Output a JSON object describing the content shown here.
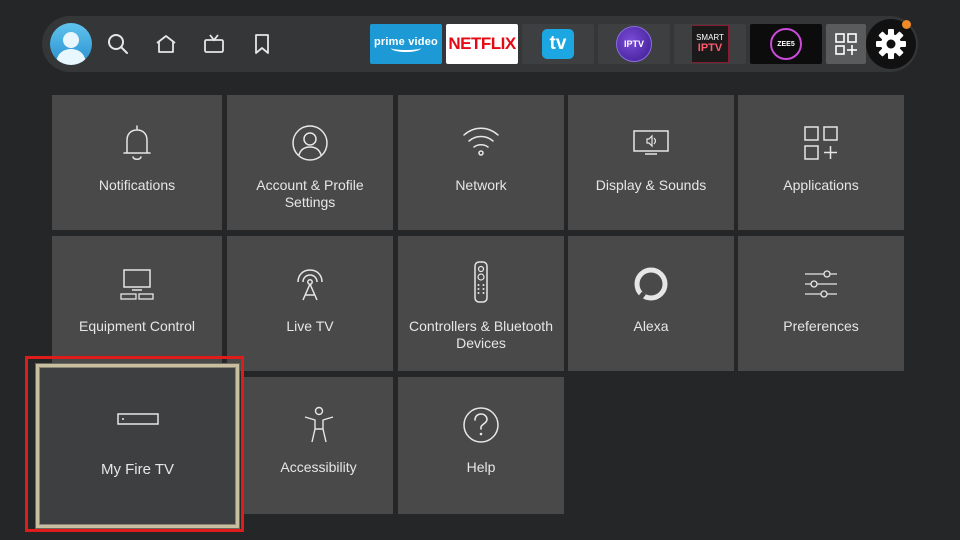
{
  "navbar": {
    "icons": [
      "profile-avatar",
      "search-icon",
      "home-icon",
      "live-tv-icon",
      "bookmark-icon"
    ],
    "apps": [
      {
        "id": "prime",
        "label": "prime video"
      },
      {
        "id": "netflix",
        "label": "NETFLIX"
      },
      {
        "id": "tv",
        "label": "tv"
      },
      {
        "id": "iptv1",
        "label": "IPTV"
      },
      {
        "id": "iptv2",
        "top": "SMART",
        "label": "IPTV"
      },
      {
        "id": "zee",
        "label": "ZEE5"
      }
    ],
    "settings_has_notification": true,
    "notification_color": "#f08a24"
  },
  "settings": {
    "items": [
      {
        "label": "Notifications",
        "icon": "bell-icon"
      },
      {
        "label": "Account & Profile Settings",
        "icon": "person-icon"
      },
      {
        "label": "Network",
        "icon": "wifi-icon"
      },
      {
        "label": "Display & Sounds",
        "icon": "display-icon"
      },
      {
        "label": "Applications",
        "icon": "applications-icon"
      },
      {
        "label": "Equipment Control",
        "icon": "equipment-icon"
      },
      {
        "label": "Live TV",
        "icon": "antenna-icon"
      },
      {
        "label": "Controllers & Bluetooth Devices",
        "icon": "remote-icon"
      },
      {
        "label": "Alexa",
        "icon": "alexa-icon"
      },
      {
        "label": "Preferences",
        "icon": "sliders-icon"
      },
      {
        "label": "My Fire TV",
        "icon": "fire-tv-device-icon",
        "focused": true
      },
      {
        "label": "Accessibility",
        "icon": "accessibility-icon"
      },
      {
        "label": "Help",
        "icon": "help-icon"
      }
    ]
  },
  "colors": {
    "background": "#252627",
    "tile": "#494949",
    "focus_border": "#c8bea0",
    "annotation_red": "#e01b1b"
  }
}
